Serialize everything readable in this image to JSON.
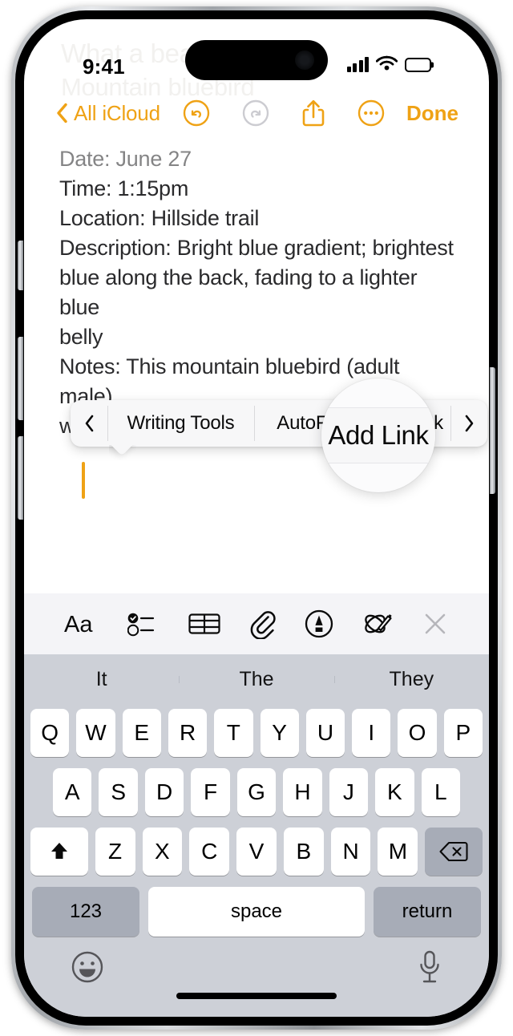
{
  "device": {
    "buttons": {
      "action": "action-button",
      "volume_up": "volume-up",
      "volume_down": "volume-down",
      "power": "power-button"
    }
  },
  "status_bar": {
    "time": "9:41",
    "signal_icon": "cellular-signal-icon",
    "signal_bars": 4,
    "wifi_icon": "wifi-icon",
    "battery_icon": "battery-icon",
    "battery_full": true
  },
  "ghost_content": {
    "title": "What a beauty!",
    "subtitle": "Mountain bluebird"
  },
  "nav_bar": {
    "back_label": "All iCloud",
    "back_icon": "chevron-left-icon",
    "undo_icon": "undo-icon",
    "undo_enabled": true,
    "redo_icon": "redo-icon",
    "redo_enabled": false,
    "share_icon": "share-icon",
    "more_icon": "more-ellipsis-icon",
    "done_label": "Done",
    "accent_color": "#EFA215",
    "disabled_color": "#C9C9CE"
  },
  "note": {
    "lines": [
      "Date: June 27",
      "Time: 1:15pm",
      "Location: Hillside trail",
      "Description: Bright blue gradient; brightest",
      "blue along the back, fading to a lighter blue",
      "belly",
      "Notes: This mountain bluebird (adult male)",
      "was on the lookout for bugs."
    ],
    "caret_color": "#EFA215"
  },
  "edit_menu": {
    "prev_icon": "chevron-left-icon",
    "next_icon": "chevron-right-icon",
    "items": [
      {
        "label": "Writing Tools"
      },
      {
        "label": "AutoFill"
      },
      {
        "label": "Add Link"
      }
    ]
  },
  "magnifier": {
    "highlighted_label": "Add Link"
  },
  "format_toolbar": {
    "items": [
      {
        "name": "text-format-icon",
        "label": "Aa"
      },
      {
        "name": "checklist-icon",
        "label": ""
      },
      {
        "name": "table-icon",
        "label": ""
      },
      {
        "name": "attachment-paperclip-icon",
        "label": ""
      },
      {
        "name": "markup-pen-icon",
        "label": ""
      },
      {
        "name": "image-playground-icon",
        "label": ""
      },
      {
        "name": "close-icon",
        "label": ""
      }
    ]
  },
  "keyboard": {
    "predictions": [
      "It",
      "The",
      "They"
    ],
    "row1": [
      "Q",
      "W",
      "E",
      "R",
      "T",
      "Y",
      "U",
      "I",
      "O",
      "P"
    ],
    "row2": [
      "A",
      "S",
      "D",
      "F",
      "G",
      "H",
      "J",
      "K",
      "L"
    ],
    "row3_letters": [
      "Z",
      "X",
      "C",
      "V",
      "B",
      "N",
      "M"
    ],
    "shift_icon": "shift-up-arrow-icon",
    "shift_active": true,
    "delete_icon": "delete-backspace-icon",
    "numbers_label": "123",
    "space_label": "space",
    "return_label": "return",
    "emoji_icon": "emoji-smiley-icon",
    "dictation_icon": "microphone-icon"
  }
}
